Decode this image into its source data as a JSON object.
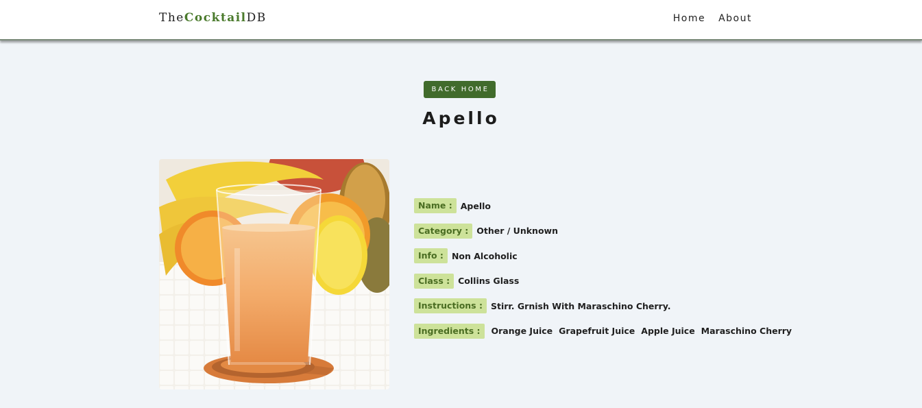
{
  "brand": {
    "prefix": "The",
    "accent": "Cocktail",
    "suffix": "DB",
    "accent_color": "#4a7a2c"
  },
  "nav": {
    "items": [
      "Home",
      "About"
    ]
  },
  "back_button": {
    "label": "BACK HOME",
    "color": "#416b2c"
  },
  "drink": {
    "title": "Apello",
    "fields": {
      "name": {
        "label": "Name :",
        "value": "Apello"
      },
      "category": {
        "label": "Category :",
        "value": "Other / Unknown"
      },
      "info": {
        "label": "Info :",
        "value": "Non Alcoholic"
      },
      "glass": {
        "label": "Class :",
        "value": "Collins Glass"
      },
      "instructions": {
        "label": "Instructions :",
        "value": "Stirr. Grnish With Maraschino Cherry."
      },
      "ingredients": {
        "label": "Ingredients :",
        "items": [
          "Orange Juice",
          "Grapefruit Juice",
          "Apple Juice",
          "Maraschino Cherry"
        ]
      }
    }
  },
  "colors": {
    "tag_bg": "#cde29a",
    "tag_text": "#4a6d22",
    "page_bg": "#f0f4f8"
  }
}
